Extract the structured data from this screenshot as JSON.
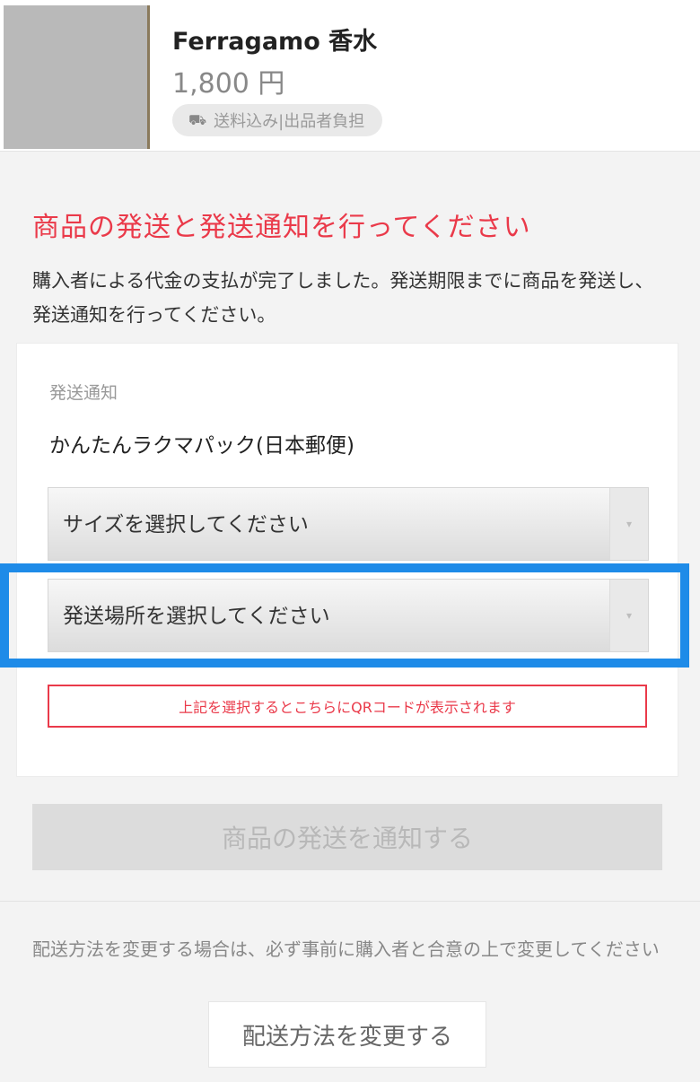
{
  "product": {
    "name": "Ferragamo 香水",
    "price": "1,800 円",
    "shipping_badge": "送料込み|出品者負担",
    "shipping_icon": "truck-icon"
  },
  "instruction": {
    "heading": "商品の発送と発送通知を行ってください",
    "description": "購入者による代金の支払が完了しました。発送期限までに商品を発送し、発送通知を行ってください。"
  },
  "notification_card": {
    "label": "発送通知",
    "method": "かんたんラクマパック(日本郵便)",
    "size_select": "サイズを選択してください",
    "location_select": "発送場所を選択してください",
    "qr_notice": "上記を選択するとこちらにQRコードが表示されます"
  },
  "notify_button": "商品の発送を通知する",
  "change_section": {
    "note": "配送方法を変更する場合は、必ず事前に購入者と合意の上で変更してください",
    "button": "配送方法を変更する"
  },
  "colors": {
    "accent_red": "#ea3a4a",
    "highlight_blue": "#1e8be8"
  }
}
